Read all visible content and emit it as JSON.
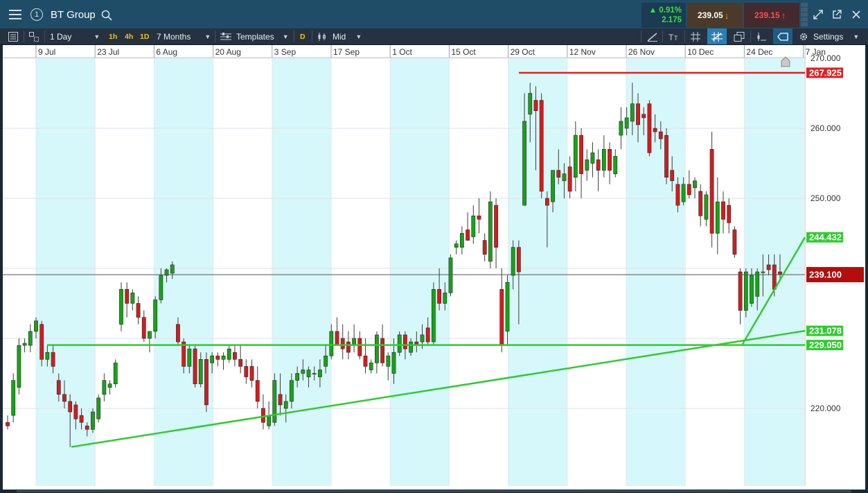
{
  "window": {
    "instrument": "BT Group",
    "number_badge": "1",
    "change_percent": "0.91%",
    "change_abs": "2.175",
    "sell_price": "239.05",
    "buy_price": "239.15",
    "colors": {
      "up": "#3be03b",
      "down": "#ff4d4d",
      "accent": "#1f4d68"
    }
  },
  "toolbar": {
    "interval": "1 Day",
    "quick_intervals": [
      "1h",
      "4h",
      "1D"
    ],
    "range": "7 Months",
    "templates": "Templates",
    "d_badge": "D",
    "price_type": "Mid",
    "settings": "Settings"
  },
  "chart_data": {
    "type": "candlestick",
    "x_tick_labels": [
      "9 Jul",
      "23 Jul",
      "6 Aug",
      "20 Aug",
      "3 Sep",
      "17 Sep",
      "1 Oct",
      "15 Oct",
      "29 Oct",
      "12 Nov",
      "26 Nov",
      "10 Dec",
      "24 Dec",
      "7 Jan"
    ],
    "y_tick_labels": [
      "270.000",
      "260.000",
      "250.000",
      "220.000"
    ],
    "y_range": [
      212,
      270.5
    ],
    "current_price_label": "239.100",
    "current_price": 239.1,
    "annotations": [
      {
        "label": "267.925",
        "value": 267.925,
        "color": "#e02020",
        "kind": "horizontal"
      },
      {
        "label": "244.432",
        "value": 244.432,
        "color": "#2ecc2e",
        "kind": "trend"
      },
      {
        "label": "231.078",
        "value": 231.078,
        "color": "#2ecc2e",
        "kind": "trend"
      },
      {
        "label": "229.050",
        "value": 229.05,
        "color": "#2ecc2e",
        "kind": "horizontal"
      }
    ],
    "candles": [
      {
        "o": 218,
        "h": 219,
        "l": 217,
        "c": 217.5
      },
      {
        "o": 219,
        "h": 225,
        "l": 218,
        "c": 224
      },
      {
        "o": 223,
        "h": 230,
        "l": 222,
        "c": 229
      },
      {
        "o": 229,
        "h": 230,
        "l": 228,
        "c": 229.3
      },
      {
        "o": 229,
        "h": 232,
        "l": 228,
        "c": 231
      },
      {
        "o": 231,
        "h": 233,
        "l": 230,
        "c": 232.5
      },
      {
        "o": 232,
        "h": 232.5,
        "l": 226,
        "c": 227
      },
      {
        "o": 227,
        "h": 229,
        "l": 226,
        "c": 228
      },
      {
        "o": 228,
        "h": 229,
        "l": 225,
        "c": 226
      },
      {
        "o": 224,
        "h": 225,
        "l": 221,
        "c": 222
      },
      {
        "o": 222,
        "h": 224,
        "l": 220,
        "c": 221
      },
      {
        "o": 221,
        "h": 222,
        "l": 214.5,
        "c": 219.5
      },
      {
        "o": 220.5,
        "h": 221,
        "l": 217,
        "c": 218.5
      },
      {
        "o": 219,
        "h": 220,
        "l": 217,
        "c": 218
      },
      {
        "o": 217.5,
        "h": 218,
        "l": 216,
        "c": 217
      },
      {
        "o": 217,
        "h": 220,
        "l": 216.5,
        "c": 219.5
      },
      {
        "o": 218.5,
        "h": 222,
        "l": 218,
        "c": 221.5
      },
      {
        "o": 222,
        "h": 225,
        "l": 221,
        "c": 224
      },
      {
        "o": 223,
        "h": 224,
        "l": 222,
        "c": 223.5
      },
      {
        "o": 223.5,
        "h": 227,
        "l": 223,
        "c": 226.5
      },
      {
        "o": 232,
        "h": 238,
        "l": 231,
        "c": 237
      },
      {
        "o": 237,
        "h": 238,
        "l": 233,
        "c": 235
      },
      {
        "o": 235,
        "h": 237,
        "l": 234,
        "c": 236.5
      },
      {
        "o": 235,
        "h": 236,
        "l": 232,
        "c": 233
      },
      {
        "o": 233,
        "h": 234,
        "l": 229.5,
        "c": 230
      },
      {
        "o": 230,
        "h": 231,
        "l": 228,
        "c": 231
      },
      {
        "o": 231,
        "h": 236,
        "l": 230,
        "c": 235.5
      },
      {
        "o": 235.5,
        "h": 240,
        "l": 235,
        "c": 239
      },
      {
        "o": 239,
        "h": 240,
        "l": 238,
        "c": 239.8
      },
      {
        "o": 239.3,
        "h": 241,
        "l": 238.5,
        "c": 240.5
      },
      {
        "o": 232,
        "h": 233,
        "l": 229,
        "c": 229.5
      },
      {
        "o": 229.5,
        "h": 230,
        "l": 225,
        "c": 226
      },
      {
        "o": 226,
        "h": 229,
        "l": 225,
        "c": 228.5
      },
      {
        "o": 228.5,
        "h": 229,
        "l": 223,
        "c": 223.5
      },
      {
        "o": 223.5,
        "h": 228,
        "l": 223,
        "c": 227
      },
      {
        "o": 227,
        "h": 228,
        "l": 219.5,
        "c": 220.5
      },
      {
        "o": 226.5,
        "h": 228,
        "l": 225,
        "c": 227.5
      },
      {
        "o": 227.5,
        "h": 228,
        "l": 226,
        "c": 227
      },
      {
        "o": 227,
        "h": 228,
        "l": 225.5,
        "c": 227.5
      },
      {
        "o": 227,
        "h": 229,
        "l": 226.5,
        "c": 228.5
      },
      {
        "o": 228,
        "h": 229,
        "l": 226,
        "c": 227
      },
      {
        "o": 227,
        "h": 229,
        "l": 225,
        "c": 226
      },
      {
        "o": 226,
        "h": 227,
        "l": 223.5,
        "c": 224.5
      },
      {
        "o": 226,
        "h": 227,
        "l": 223,
        "c": 224
      },
      {
        "o": 224,
        "h": 226,
        "l": 220,
        "c": 221
      },
      {
        "o": 220,
        "h": 222,
        "l": 217,
        "c": 218
      },
      {
        "o": 217.5,
        "h": 221,
        "l": 217,
        "c": 219
      },
      {
        "o": 218,
        "h": 225,
        "l": 217.5,
        "c": 224
      },
      {
        "o": 222,
        "h": 225,
        "l": 219,
        "c": 220.5
      },
      {
        "o": 220,
        "h": 222,
        "l": 218,
        "c": 221
      },
      {
        "o": 221,
        "h": 225,
        "l": 220,
        "c": 224
      },
      {
        "o": 224,
        "h": 226,
        "l": 223,
        "c": 225
      },
      {
        "o": 225,
        "h": 227,
        "l": 224,
        "c": 225.5
      },
      {
        "o": 224.5,
        "h": 226,
        "l": 223,
        "c": 225.5
      },
      {
        "o": 225,
        "h": 226,
        "l": 224,
        "c": 225
      },
      {
        "o": 224.5,
        "h": 227,
        "l": 223,
        "c": 225.5
      },
      {
        "o": 226,
        "h": 229,
        "l": 225,
        "c": 227.5
      },
      {
        "o": 227.5,
        "h": 232,
        "l": 227,
        "c": 231
      },
      {
        "o": 231,
        "h": 233,
        "l": 230,
        "c": 229
      },
      {
        "o": 230,
        "h": 232,
        "l": 227,
        "c": 228.5
      },
      {
        "o": 229.5,
        "h": 231,
        "l": 227,
        "c": 228
      },
      {
        "o": 229,
        "h": 232,
        "l": 228,
        "c": 230
      },
      {
        "o": 230,
        "h": 231,
        "l": 227,
        "c": 227.5
      },
      {
        "o": 227.5,
        "h": 230,
        "l": 225,
        "c": 226
      },
      {
        "o": 225.5,
        "h": 227,
        "l": 225,
        "c": 226.5
      },
      {
        "o": 226.5,
        "h": 231,
        "l": 225,
        "c": 230.5
      },
      {
        "o": 230,
        "h": 232,
        "l": 226,
        "c": 226.5
      },
      {
        "o": 226,
        "h": 228,
        "l": 224,
        "c": 227.5
      },
      {
        "o": 225,
        "h": 230,
        "l": 223.5,
        "c": 228
      },
      {
        "o": 228,
        "h": 231,
        "l": 227.5,
        "c": 230.5
      },
      {
        "o": 230.5,
        "h": 231,
        "l": 227,
        "c": 228.5
      },
      {
        "o": 228,
        "h": 230,
        "l": 227.5,
        "c": 229.5
      },
      {
        "o": 229.5,
        "h": 231,
        "l": 228,
        "c": 229
      },
      {
        "o": 229.5,
        "h": 232,
        "l": 228.5,
        "c": 230.5
      },
      {
        "o": 231.5,
        "h": 233,
        "l": 229,
        "c": 229.5
      },
      {
        "o": 229.5,
        "h": 238,
        "l": 229,
        "c": 237
      },
      {
        "o": 237,
        "h": 240,
        "l": 234,
        "c": 235
      },
      {
        "o": 235,
        "h": 238,
        "l": 234,
        "c": 236.5
      },
      {
        "o": 236.5,
        "h": 242,
        "l": 236,
        "c": 241.5
      },
      {
        "o": 243,
        "h": 244,
        "l": 242,
        "c": 243.5
      },
      {
        "o": 243,
        "h": 246,
        "l": 242,
        "c": 245
      },
      {
        "o": 245.5,
        "h": 248,
        "l": 244,
        "c": 244
      },
      {
        "o": 244.5,
        "h": 249,
        "l": 243.5,
        "c": 247.5
      },
      {
        "o": 247.5,
        "h": 250,
        "l": 245,
        "c": 247
      },
      {
        "o": 244,
        "h": 245,
        "l": 241,
        "c": 242
      },
      {
        "o": 241,
        "h": 251,
        "l": 240,
        "c": 249.5
      },
      {
        "o": 249,
        "h": 250,
        "l": 240,
        "c": 243
      },
      {
        "o": 237,
        "h": 240,
        "l": 228,
        "c": 229
      },
      {
        "o": 231,
        "h": 239,
        "l": 229,
        "c": 238
      },
      {
        "o": 239,
        "h": 244,
        "l": 237,
        "c": 243
      },
      {
        "o": 243,
        "h": 244,
        "l": 232,
        "c": 239.5
      },
      {
        "o": 249,
        "h": 265,
        "l": 249,
        "c": 261
      },
      {
        "o": 262,
        "h": 266.5,
        "l": 258,
        "c": 265
      },
      {
        "o": 264,
        "h": 266,
        "l": 254,
        "c": 262.5
      },
      {
        "o": 264,
        "h": 265,
        "l": 250,
        "c": 251
      },
      {
        "o": 250,
        "h": 251,
        "l": 243,
        "c": 249
      },
      {
        "o": 249.5,
        "h": 254,
        "l": 248,
        "c": 254
      },
      {
        "o": 254,
        "h": 257,
        "l": 252,
        "c": 253
      },
      {
        "o": 252.5,
        "h": 255,
        "l": 250,
        "c": 253.5
      },
      {
        "o": 254.5,
        "h": 256,
        "l": 250,
        "c": 251
      },
      {
        "o": 253,
        "h": 261,
        "l": 251,
        "c": 259
      },
      {
        "o": 259,
        "h": 260,
        "l": 250,
        "c": 253.5
      },
      {
        "o": 254,
        "h": 257,
        "l": 252.5,
        "c": 255.5
      },
      {
        "o": 255,
        "h": 258,
        "l": 253,
        "c": 256.5
      },
      {
        "o": 255.5,
        "h": 257,
        "l": 251,
        "c": 254
      },
      {
        "o": 254,
        "h": 259,
        "l": 253,
        "c": 257
      },
      {
        "o": 257,
        "h": 258,
        "l": 252,
        "c": 254
      },
      {
        "o": 253.5,
        "h": 257,
        "l": 253,
        "c": 256
      },
      {
        "o": 259,
        "h": 263,
        "l": 257,
        "c": 261
      },
      {
        "o": 260,
        "h": 263,
        "l": 259,
        "c": 261.5
      },
      {
        "o": 261,
        "h": 266.5,
        "l": 259,
        "c": 263.5
      },
      {
        "o": 263.5,
        "h": 265,
        "l": 258,
        "c": 260.5
      },
      {
        "o": 262,
        "h": 263,
        "l": 259,
        "c": 261.5
      },
      {
        "o": 263.5,
        "h": 264,
        "l": 256,
        "c": 256.5
      },
      {
        "o": 260,
        "h": 262,
        "l": 258,
        "c": 259.5
      },
      {
        "o": 259.5,
        "h": 261,
        "l": 257,
        "c": 258.5
      },
      {
        "o": 259,
        "h": 260,
        "l": 252,
        "c": 253
      },
      {
        "o": 254,
        "h": 256,
        "l": 251,
        "c": 252.5
      },
      {
        "o": 252,
        "h": 253,
        "l": 248,
        "c": 249
      },
      {
        "o": 249.5,
        "h": 253,
        "l": 249,
        "c": 252
      },
      {
        "o": 252,
        "h": 254,
        "l": 250,
        "c": 250.5
      },
      {
        "o": 251.5,
        "h": 253,
        "l": 250,
        "c": 252.5
      },
      {
        "o": 251,
        "h": 252,
        "l": 246,
        "c": 247.5
      },
      {
        "o": 247,
        "h": 251,
        "l": 246,
        "c": 250.5
      },
      {
        "o": 257,
        "h": 259.5,
        "l": 243,
        "c": 245
      },
      {
        "o": 245,
        "h": 253,
        "l": 242,
        "c": 249.5
      },
      {
        "o": 249.5,
        "h": 251,
        "l": 245,
        "c": 247
      },
      {
        "o": 249,
        "h": 250,
        "l": 245,
        "c": 246.5
      },
      {
        "o": 245.5,
        "h": 246,
        "l": 241.5,
        "c": 242
      },
      {
        "o": 239.5,
        "h": 240,
        "l": 232,
        "c": 234
      },
      {
        "o": 234,
        "h": 240,
        "l": 233,
        "c": 239.5
      },
      {
        "o": 235,
        "h": 240,
        "l": 234.5,
        "c": 239
      },
      {
        "o": 236,
        "h": 240,
        "l": 234,
        "c": 239.5
      },
      {
        "o": 239.5,
        "h": 242,
        "l": 236,
        "c": 239.5
      },
      {
        "o": 240.5,
        "h": 242,
        "l": 239,
        "c": 239.8
      },
      {
        "o": 240.5,
        "h": 242,
        "l": 236,
        "c": 237
      },
      {
        "o": 239.5,
        "h": 242,
        "l": 238.5,
        "c": 239.1
      }
    ]
  }
}
